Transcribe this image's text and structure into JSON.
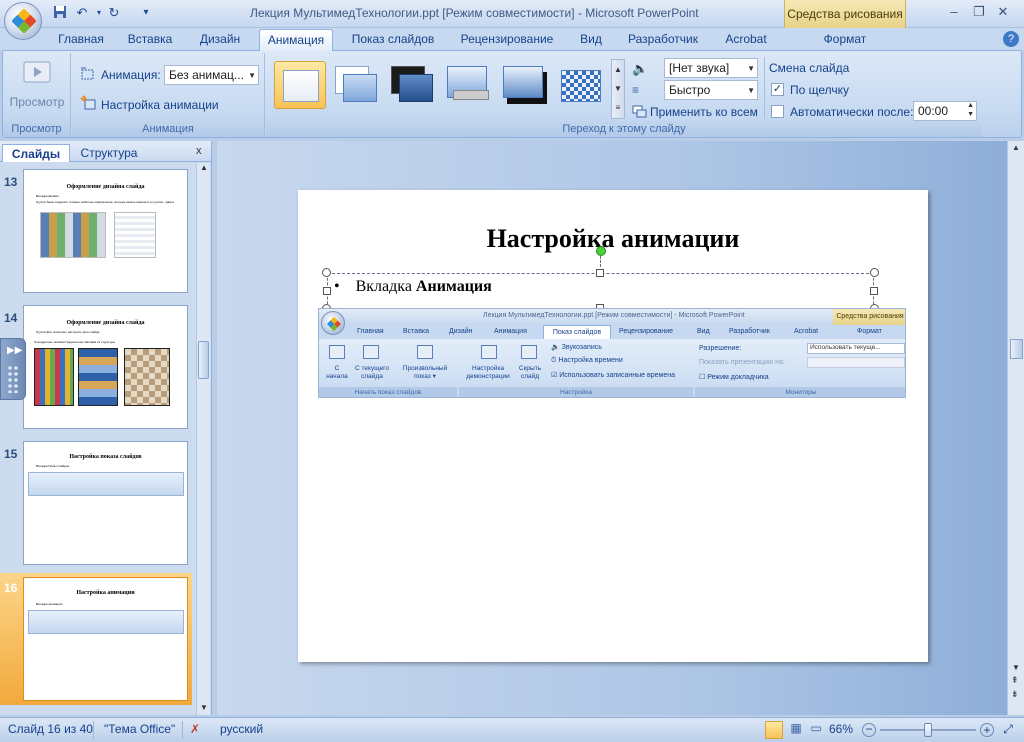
{
  "title_bar": {
    "window_title": "Лекция МультимедТехнологии.ppt [Режим совместимости] - Microsoft PowerPoint",
    "context_tool_title": "Средства рисования",
    "qat_icons": [
      "save-icon",
      "undo-icon",
      "redo-icon",
      "customize-icon"
    ]
  },
  "tabs": [
    "Главная",
    "Вставка",
    "Дизайн",
    "Анимация",
    "Показ слайдов",
    "Рецензирование",
    "Вид",
    "Разработчик",
    "Acrobat",
    "Формат"
  ],
  "active_tab": "Анимация",
  "ribbon": {
    "preview": {
      "button_label": "Просмотр",
      "group_label": "Просмотр"
    },
    "animation": {
      "animation_label": "Анимация:",
      "animation_value": "Без анимац...",
      "custom_animation_label": "Настройка анимации",
      "group_label": "Анимация"
    },
    "transition": {
      "sound_value": "[Нет звука]",
      "speed_value": "Быстро",
      "apply_all_label": "Применить ко всем",
      "advance_heading": "Смена слайда",
      "on_click_label": "По щелчку",
      "on_click_checked": true,
      "auto_after_label": "Автоматически после:",
      "auto_after_checked": false,
      "auto_after_value": "00:00",
      "group_label": "Переход к этому слайду"
    }
  },
  "left_pane": {
    "tab_slides": "Слайды",
    "tab_outline": "Структура",
    "close_glyph": "x",
    "thumbnails": [
      {
        "number": "13",
        "title": "Оформление дизайна слайда",
        "lines": [
          "Вкладка Дизайн",
          "Группа Темы содержит готовые шаблоны оформления, которые можно изменить в группах...Цвета"
        ]
      },
      {
        "number": "14",
        "title": "Оформление дизайна слайда",
        "lines": [
          "Группа Фон позволяет настроить фон слайда",
          "Стандартные заливки   Градиентные   Заливка из структуры"
        ]
      },
      {
        "number": "15",
        "title": "Настройка показа слайдов",
        "lines": [
          "Вкладка Показ слайдов"
        ]
      },
      {
        "number": "16",
        "title": "Настройка анимации",
        "lines": [
          "Вкладка Анимация"
        ]
      }
    ],
    "selected_slide": "16"
  },
  "slide": {
    "title": "Настройка анимации",
    "bullet_prefix": "Вкладка ",
    "bullet_bold": "Анимация",
    "screenshot": {
      "window_title": "Лекция МультимедТехнологии.ppt [Режим совместимости] - Microsoft PowerPoint",
      "context_title": "Средства рисования",
      "tabs": [
        "Главная",
        "Вставка",
        "Дизайн",
        "Анимация",
        "Показ слайдов",
        "Рецензирование",
        "Вид",
        "Разработчик",
        "Acrobat",
        "Формат"
      ],
      "active_tab": "Показ слайдов",
      "btn_from_start": [
        "С",
        "начала"
      ],
      "btn_from_current": [
        "С текущего",
        "слайда"
      ],
      "btn_custom": [
        "Произвольный",
        "показ ▾"
      ],
      "group1": "Начать показ слайдов",
      "btn_setup": [
        "Настройка",
        "демонстрации"
      ],
      "btn_hide": [
        "Скрыть",
        "слайд"
      ],
      "record_narration": "Звукозапись",
      "rehearse_timings": "Настройка времени",
      "use_timings": "Использовать записанные времена",
      "group2": "Настройка",
      "resolution_label": "Разрешение:",
      "resolution_value": "Использовать текуще...",
      "show_on_label": "Показать презентацию на:",
      "presenter_view": "Режим докладчика",
      "group3": "Мониторы"
    }
  },
  "status_bar": {
    "slide_info": "Слайд 16 из 40",
    "theme": "\"Тема Office\"",
    "language": "русский",
    "zoom": "66%",
    "zoom_level": 0.5
  }
}
